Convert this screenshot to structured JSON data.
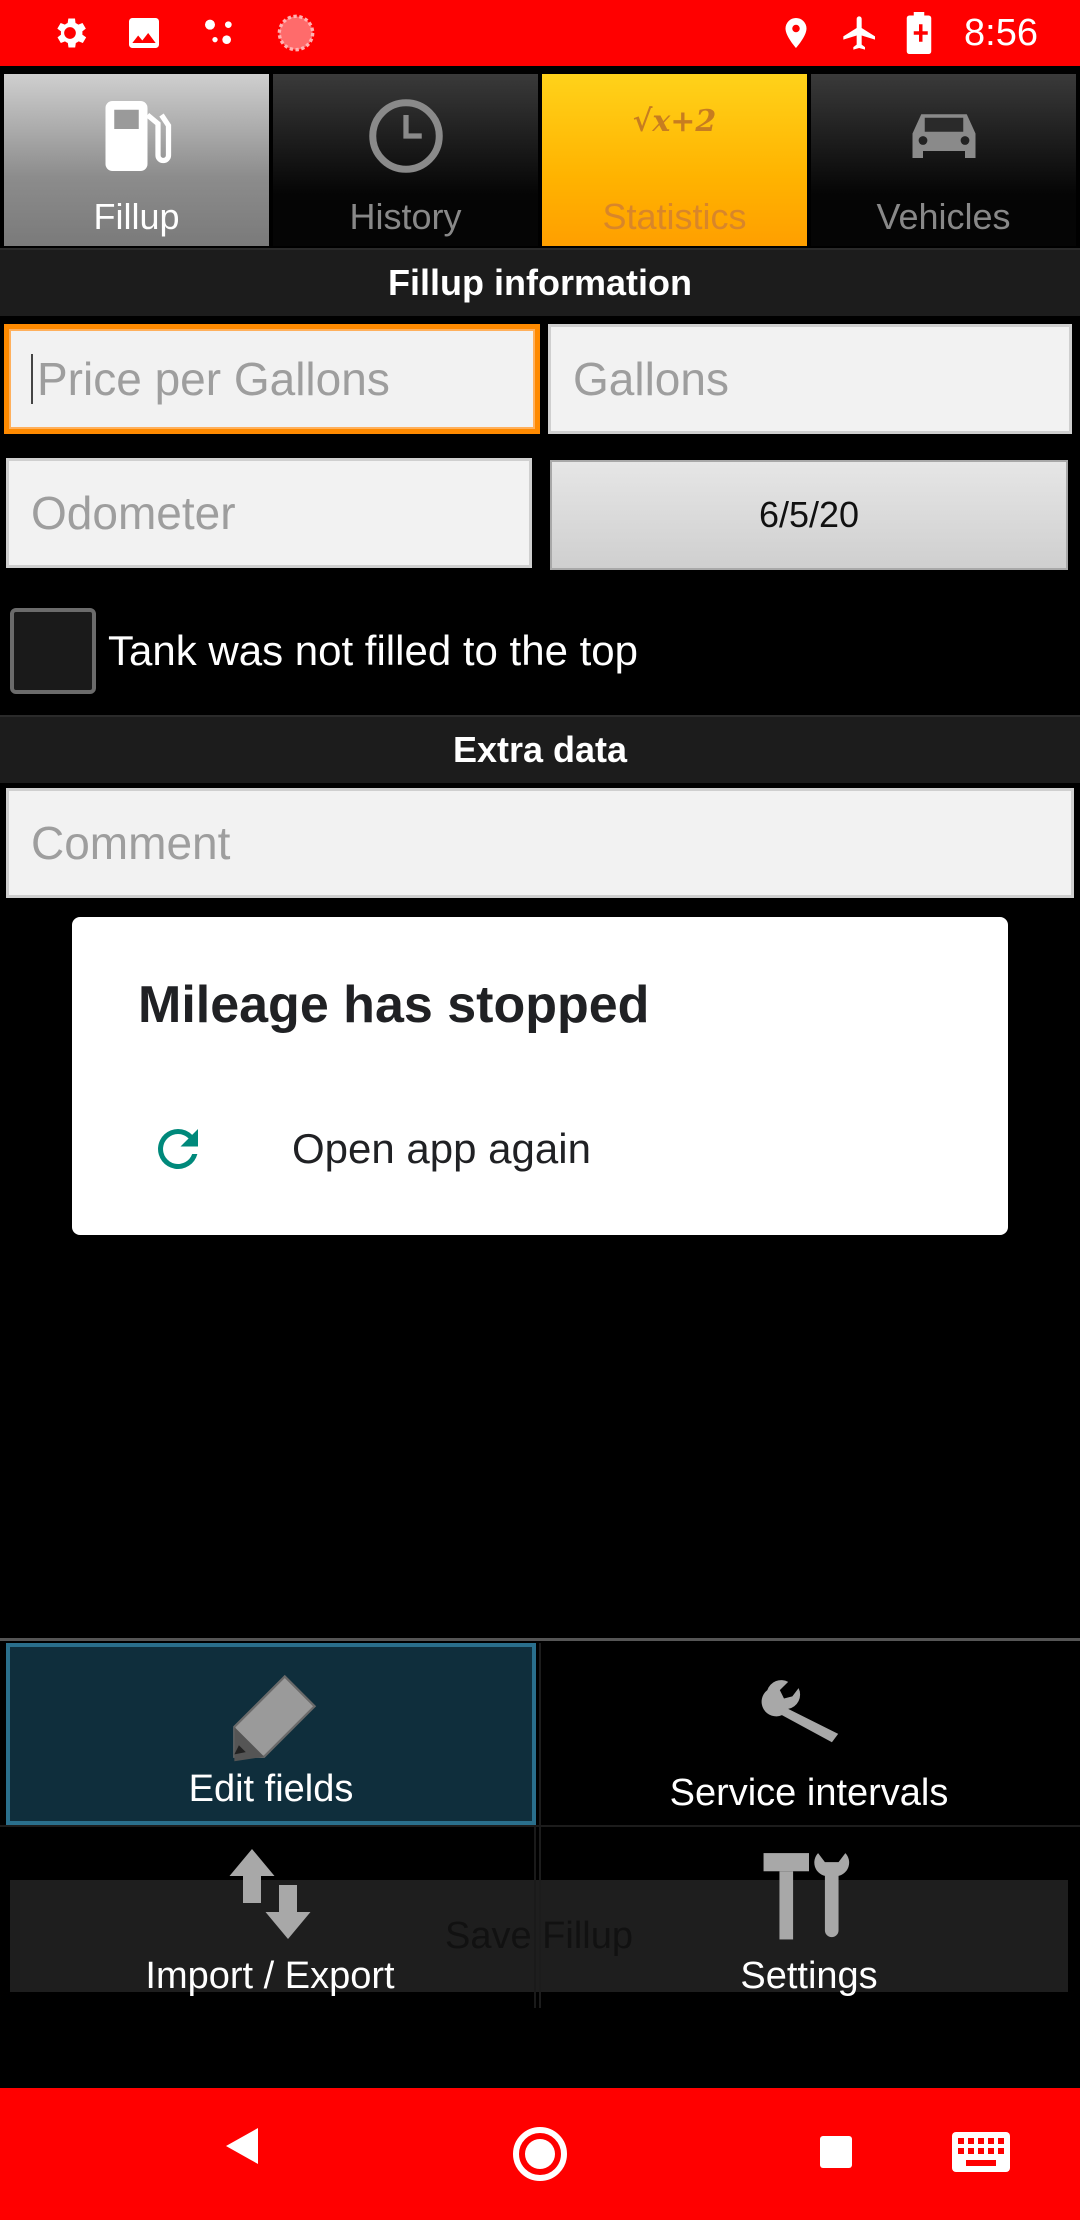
{
  "status_bar": {
    "time": "8:56",
    "left_icons": [
      "gear-icon",
      "image-icon",
      "assistant-dots-icon",
      "record-icon"
    ],
    "right_icons": [
      "location-icon",
      "airplane-icon",
      "battery-charging-icon"
    ],
    "background": "#ff0000"
  },
  "tabs": [
    {
      "label": "Fillup",
      "icon": "fuel-pump-icon",
      "selected": true
    },
    {
      "label": "History",
      "icon": "clock-icon",
      "selected": false
    },
    {
      "label": "Statistics",
      "icon": "sqrt-formula-icon",
      "icon_text": "√x+2",
      "selected": false
    },
    {
      "label": "Vehicles",
      "icon": "car-icon",
      "selected": false
    }
  ],
  "fillup_section": {
    "header": "Fillup information",
    "price_placeholder": "Price per Gallons",
    "gallons_placeholder": "Gallons",
    "odometer_placeholder": "Odometer",
    "date_value": "6/5/20",
    "partial_fill_label": "Tank was not filled to the top",
    "partial_fill_checked": false
  },
  "extra_section": {
    "header": "Extra data",
    "comment_placeholder": "Comment"
  },
  "dialog": {
    "title": "Mileage has stopped",
    "action_label": "Open app again",
    "action_icon": "reload-icon",
    "accent": "#00897b"
  },
  "bottom_menu": {
    "save_label": "Save Fillup",
    "items": [
      {
        "label": "Edit fields",
        "icon": "pencil-icon",
        "highlighted": true
      },
      {
        "label": "Service intervals",
        "icon": "wrench-icon",
        "highlighted": false
      },
      {
        "label": "Import / Export",
        "icon": "up-down-arrows-icon",
        "highlighted": false
      },
      {
        "label": "Settings",
        "icon": "hammer-wrench-icon",
        "highlighted": false
      }
    ]
  },
  "nav_bar": {
    "buttons": [
      "back-icon",
      "home-icon",
      "recents-icon",
      "keyboard-icon"
    ]
  }
}
